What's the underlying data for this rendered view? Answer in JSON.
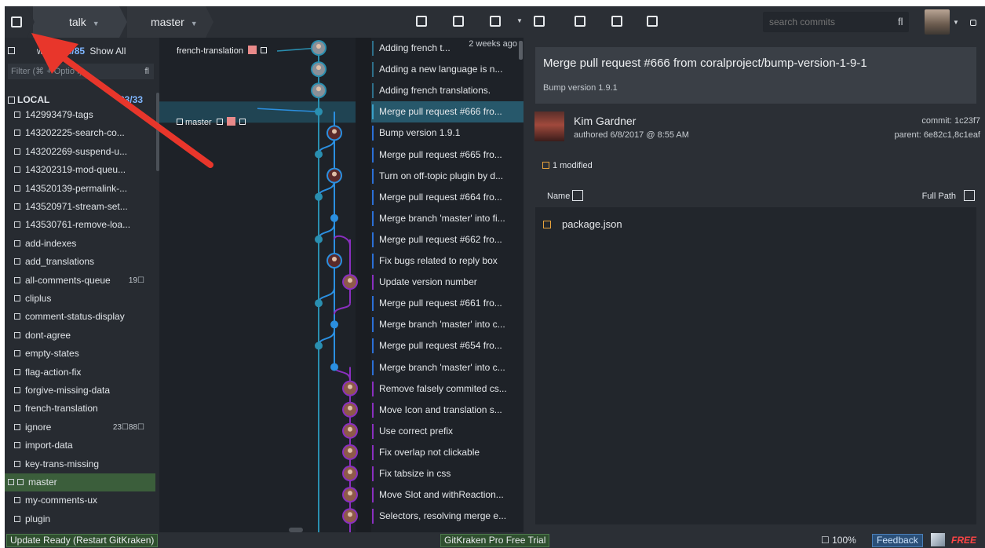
{
  "toolbar": {
    "repo": "talk",
    "branch": "master",
    "search_placeholder": "search commits",
    "search_glyph": "fl"
  },
  "left": {
    "viewing_word": "wing",
    "viewing_count": "85/85",
    "show_all": "Show All",
    "filter": "Filter (⌘ + Optio    f)",
    "filter_glyph": "fl",
    "local_label": "LOCAL",
    "local_count": "33/33",
    "branches": [
      {
        "name": "142993479-tags",
        "count": ""
      },
      {
        "name": "143202225-search-co...",
        "count": ""
      },
      {
        "name": "143202269-suspend-u...",
        "count": ""
      },
      {
        "name": "143202319-mod-queu...",
        "count": ""
      },
      {
        "name": "143520139-permalink-...",
        "count": ""
      },
      {
        "name": "143520971-stream-set...",
        "count": ""
      },
      {
        "name": "143530761-remove-loa...",
        "count": ""
      },
      {
        "name": "add-indexes",
        "count": ""
      },
      {
        "name": "add_translations",
        "count": ""
      },
      {
        "name": "all-comments-queue",
        "count": "19☐"
      },
      {
        "name": "cliplus",
        "count": ""
      },
      {
        "name": "comment-status-display",
        "count": ""
      },
      {
        "name": "dont-agree",
        "count": ""
      },
      {
        "name": "empty-states",
        "count": ""
      },
      {
        "name": "flag-action-fix",
        "count": ""
      },
      {
        "name": "forgive-missing-data",
        "count": ""
      },
      {
        "name": "french-translation",
        "count": ""
      },
      {
        "name": "ignore",
        "count": "23☐88☐"
      },
      {
        "name": "import-data",
        "count": ""
      },
      {
        "name": "key-trans-missing",
        "count": ""
      },
      {
        "name": "master",
        "count": ""
      },
      {
        "name": "my-comments-ux",
        "count": ""
      },
      {
        "name": "plugin",
        "count": ""
      }
    ]
  },
  "graph": {
    "tags": {
      "french": "french-translation",
      "master": "master"
    }
  },
  "commits": [
    {
      "msg": "Adding french t...",
      "age": "2 weeks ago",
      "color": "#2e6f8a"
    },
    {
      "msg": "Adding a new language is n...",
      "age": "",
      "color": "#2e6f8a"
    },
    {
      "msg": "Adding french translations.",
      "age": "",
      "color": "#2e6f8a"
    },
    {
      "msg": "Merge pull request #666 fro...",
      "age": "",
      "color": "#3aa0c8"
    },
    {
      "msg": "Bump version 1.9.1",
      "age": "",
      "color": "#2b6fd6"
    },
    {
      "msg": "Merge pull request #665 fro...",
      "age": "",
      "color": "#2b6fd6"
    },
    {
      "msg": "Turn on off-topic plugin by d...",
      "age": "",
      "color": "#2b6fd6"
    },
    {
      "msg": "Merge pull request #664 fro...",
      "age": "",
      "color": "#2b6fd6"
    },
    {
      "msg": "Merge branch 'master' into fi...",
      "age": "",
      "color": "#2b6fd6"
    },
    {
      "msg": "Merge pull request #662 fro...",
      "age": "",
      "color": "#2b6fd6"
    },
    {
      "msg": "Fix bugs related to reply box",
      "age": "",
      "color": "#2b6fd6"
    },
    {
      "msg": "Update version number",
      "age": "",
      "color": "#8a2fc0"
    },
    {
      "msg": "Merge pull request #661 fro...",
      "age": "",
      "color": "#2b6fd6"
    },
    {
      "msg": "Merge branch 'master' into c...",
      "age": "",
      "color": "#2b6fd6"
    },
    {
      "msg": "Merge pull request #654 fro...",
      "age": "",
      "color": "#2b6fd6"
    },
    {
      "msg": "Merge branch 'master' into c...",
      "age": "",
      "color": "#2b6fd6"
    },
    {
      "msg": "Remove falsely commited cs...",
      "age": "",
      "color": "#8a2fc0"
    },
    {
      "msg": "Move Icon and translation s...",
      "age": "",
      "color": "#8a2fc0"
    },
    {
      "msg": "Use correct prefix",
      "age": "",
      "color": "#8a2fc0"
    },
    {
      "msg": "Fix overlap not clickable",
      "age": "",
      "color": "#8a2fc0"
    },
    {
      "msg": "Fix tabsize in css",
      "age": "",
      "color": "#8a2fc0"
    },
    {
      "msg": "Move Slot and withReaction...",
      "age": "",
      "color": "#8a2fc0"
    },
    {
      "msg": "Selectors, resolving merge e...",
      "age": "",
      "color": "#8a2fc0"
    }
  ],
  "detail": {
    "title": "Merge pull request #666 from coralproject/bump-version-1-9-1",
    "subtitle": "Bump version 1.9.1",
    "author": "Kim Gardner",
    "authored": "authored 6/8/2017 @ 8:55 AM",
    "commit": "commit: 1c23f7",
    "parent": "parent: 6e82c1,8c1eaf",
    "modified": "1 modified",
    "name_col": "Name",
    "full_path": "Full Path",
    "file": "package.json"
  },
  "status": {
    "update": "Update Ready (Restart GitKraken)",
    "pro": "GitKraken Pro Free Trial",
    "zoom": "☐ 100%",
    "feedback": "Feedback",
    "free": "FREE"
  },
  "colors": {
    "master_lane": "#2b8fe0",
    "purple_lane": "#8a2fc0",
    "teal_lane": "#2a8fb0",
    "annotation_arrow": "#e8362b"
  }
}
